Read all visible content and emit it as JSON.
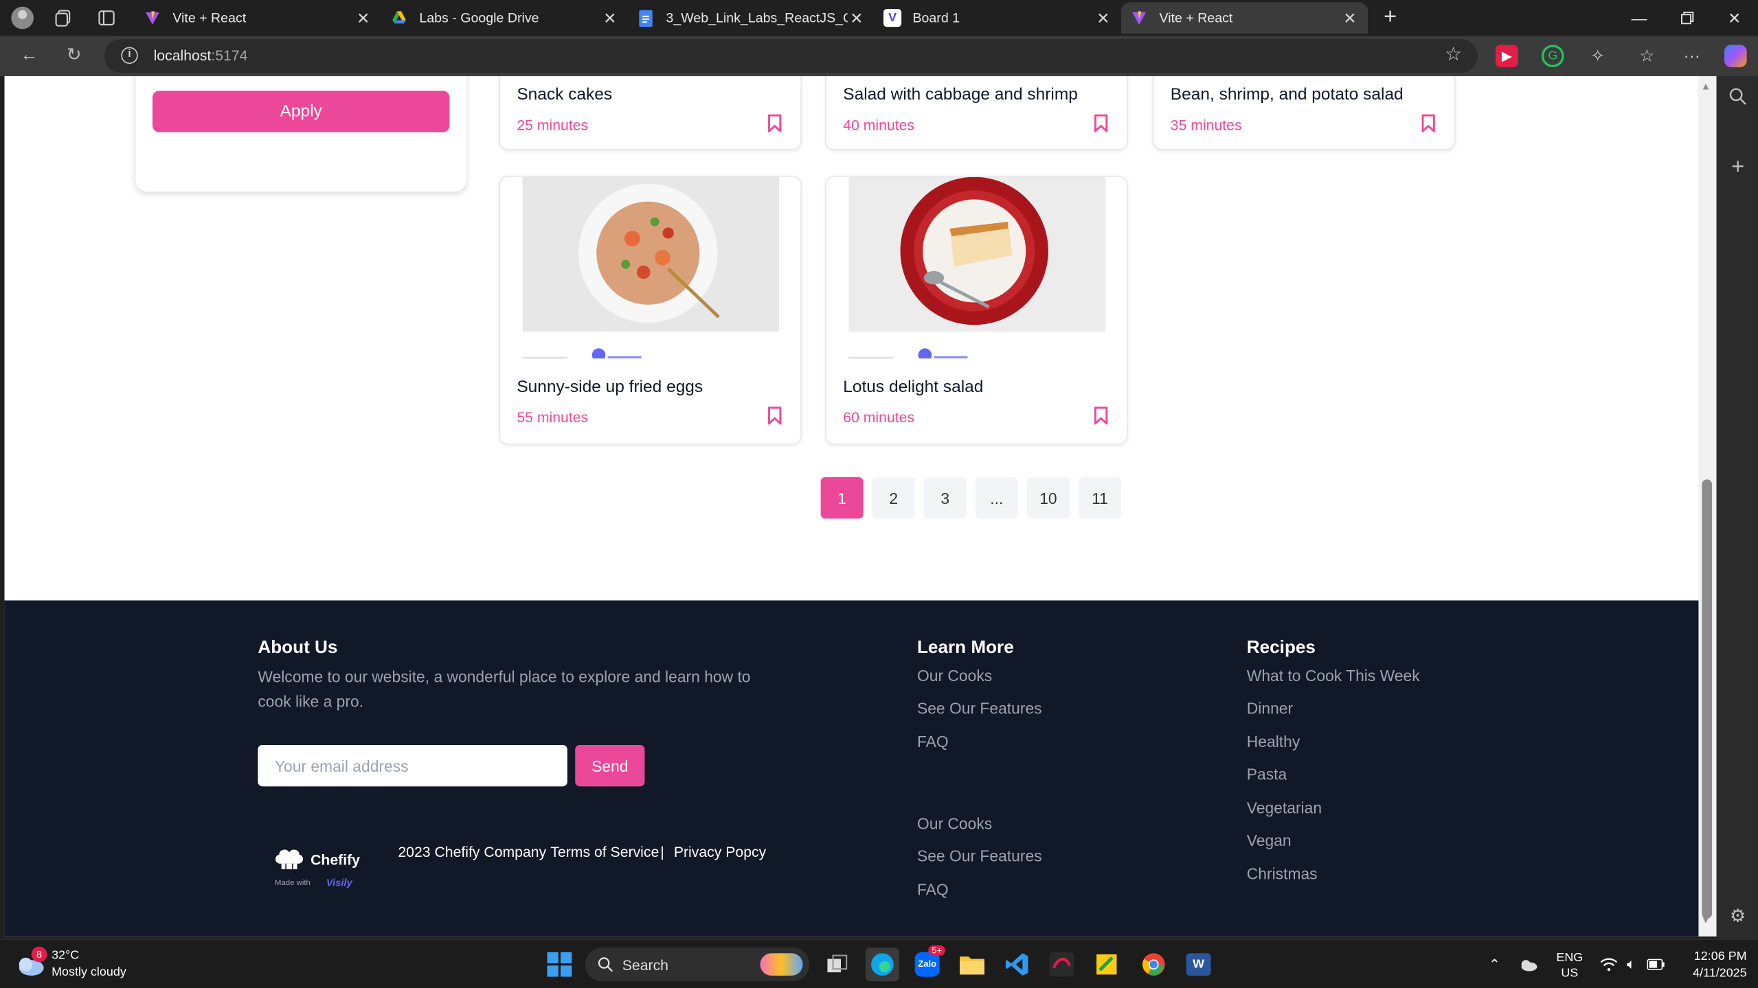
{
  "browser": {
    "tabs": [
      {
        "title": "Vite + React",
        "icon": "vite-icon",
        "active": false
      },
      {
        "title": "Labs - Google Drive",
        "icon": "google-drive-icon",
        "active": false
      },
      {
        "title": "3_Web_Link_Labs_ReactJS_Online",
        "icon": "google-docs-icon",
        "active": false
      },
      {
        "title": "Board 1",
        "icon": "visily-icon",
        "active": false
      },
      {
        "title": "Vite + React",
        "icon": "vite-icon",
        "active": true
      }
    ],
    "url_host": "localhost",
    "url_port": ":5174"
  },
  "filter": {
    "apply_label": "Apply"
  },
  "cards": [
    {
      "name": "Snack cakes",
      "time": "25 minutes"
    },
    {
      "name": "Salad with cabbage and shrimp",
      "time": "40 minutes"
    },
    {
      "name": "Bean, shrimp, and potato salad",
      "time": "35 minutes"
    },
    {
      "name": "Sunny-side up fried eggs",
      "time": "55 minutes"
    },
    {
      "name": "Lotus delight salad",
      "time": "60 minutes"
    }
  ],
  "pagination": [
    "1",
    "2",
    "3",
    "...",
    "10",
    "11"
  ],
  "footer": {
    "about_title": "About Us",
    "about_text_1": "Welcome to our website, a wonderful place to explore and learn how to",
    "about_text_2": "cook like a pro.",
    "email_placeholder": "Your email address",
    "send_label": "Send",
    "logo_text": "Chefify",
    "logo_sub_made": "Made with",
    "logo_sub_brand": "Visily",
    "copyright": "2023 Chefify Company",
    "terms": "Terms of Service",
    "separator": "|",
    "privacy": "Privacy Popcy",
    "learn_title": "Learn More",
    "learn_links": [
      "Our Cooks",
      "See Our Features",
      "FAQ"
    ],
    "learn_links_2": [
      "Our Cooks",
      "See Our Features",
      "FAQ"
    ],
    "recipes_title": "Recipes",
    "recipes_links": [
      "What to Cook This Week",
      "Dinner",
      "Healthy",
      "Pasta",
      "Vegetarian",
      "Vegan",
      "Christmas"
    ]
  },
  "taskbar": {
    "weather_temp": "32°C",
    "weather_desc": "Mostly cloudy",
    "weather_badge": "8",
    "search_label": "Search",
    "lang_1": "ENG",
    "lang_2": "US",
    "time": "12:06 PM",
    "date": "4/11/2025",
    "zalo_badge": "5+"
  },
  "colors": {
    "accent": "#ec4899",
    "footer_bg": "#111827"
  }
}
